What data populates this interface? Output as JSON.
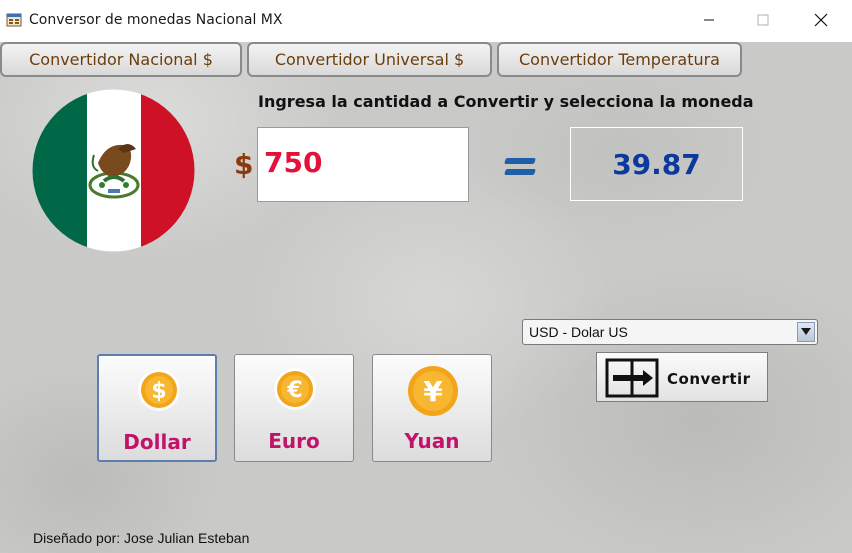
{
  "window": {
    "title": "Conversor de monedas Nacional MX"
  },
  "tabs": [
    {
      "label": "Convertidor Nacional $"
    },
    {
      "label": "Convertidor Universal $"
    },
    {
      "label": "Convertidor Temperatura"
    }
  ],
  "main": {
    "headline": "Ingresa la cantidad a Convertir y selecciona la moneda",
    "currency_symbol": "$",
    "amount_value": "750",
    "result_value": "39.87"
  },
  "currency_select": {
    "selected": "USD - Dolar US"
  },
  "convert_button": {
    "label": "Convertir"
  },
  "currency_buttons": [
    {
      "label": "Dollar",
      "symbol": "$",
      "selected": true
    },
    {
      "label": "Euro",
      "symbol": "€",
      "selected": false
    },
    {
      "label": "Yuan",
      "symbol": "¥",
      "selected": false
    }
  ],
  "footer": {
    "credit": "Diseñado por: Jose Julian Esteban"
  },
  "colors": {
    "tab_text": "#6b3e0c",
    "amount_text": "#e3123a",
    "result_text": "#0b3a9c",
    "currency_label": "#c2126a",
    "coin_gold": "#f2a51a",
    "flag_green": "#006847",
    "flag_red": "#ce1126"
  },
  "icons": {
    "app": "app-window-icon",
    "minimize": "minimize-icon",
    "maximize": "maximize-icon",
    "close": "close-icon",
    "flag": "mexico-flag-icon",
    "equals": "equals-icon",
    "convert": "convert-arrow-icon",
    "dropdown": "chevron-down-icon"
  }
}
